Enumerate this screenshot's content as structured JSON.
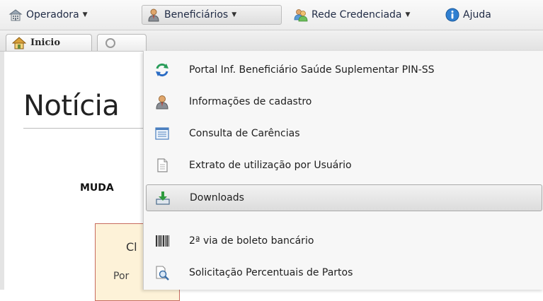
{
  "menubar": {
    "items": [
      {
        "label": "Operadora",
        "icon": "building-icon"
      },
      {
        "label": "Beneficiários",
        "icon": "user-icon"
      },
      {
        "label": "Rede Credenciada",
        "icon": "group-icon"
      },
      {
        "label": "Ajuda",
        "icon": "info-icon"
      }
    ]
  },
  "tabs": [
    {
      "label": "Inicio",
      "icon": "home-icon"
    }
  ],
  "content": {
    "title": "Notícia",
    "subhead": "MUDA",
    "notice_title": "Cl",
    "notice_text": "Por"
  },
  "dropdown": {
    "items": [
      {
        "label": "Portal Inf. Beneficiário Saúde Suplementar PIN-SS",
        "icon": "refresh-arrows-icon"
      },
      {
        "label": "Informações de cadastro",
        "icon": "user-icon"
      },
      {
        "label": "Consulta de Carências",
        "icon": "list-window-icon"
      },
      {
        "label": "Extrato de utilização por Usuário",
        "icon": "document-icon"
      },
      {
        "label": "Downloads",
        "icon": "download-tray-icon"
      },
      {
        "label": "2ª via de boleto bancário",
        "icon": "barcode-icon"
      },
      {
        "label": "Solicitação Percentuais de Partos",
        "icon": "magnifier-document-icon"
      }
    ],
    "active_index": 4
  }
}
